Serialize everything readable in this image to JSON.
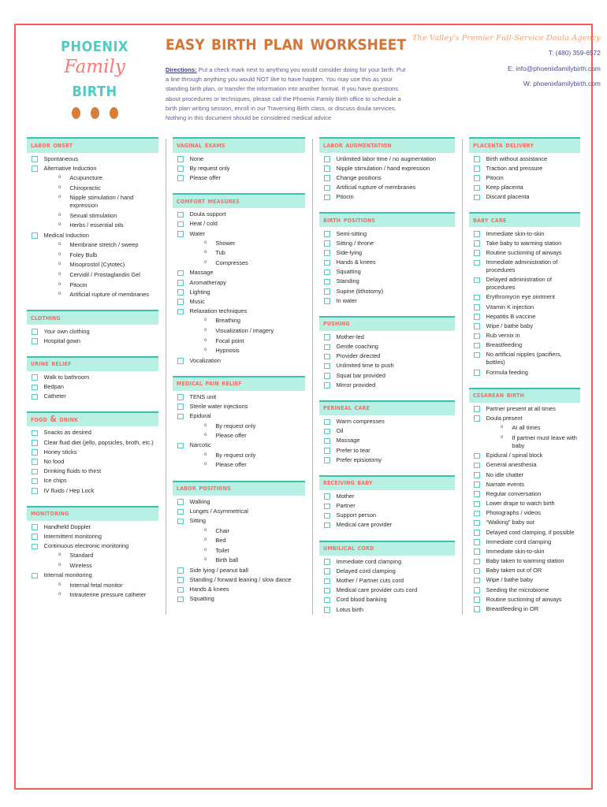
{
  "logo": {
    "line1": "Phoenix",
    "line2": "Family",
    "line3": "Birth",
    "dot_color": "#d4803c",
    "teal": "#4ecdc4",
    "coral": "#fb7a72"
  },
  "header": {
    "title": "Easy Birth Plan Worksheet",
    "directions_label": "Directions:",
    "directions_text": " Put a check mark next to anything you would consider doing for your birth. Put a line through anything you would NOT like to have happen. You may use this as your standing birth plan, or transfer the information into another format. If you have questions about procedures or techniques, please call the Phoenix Family Birth office to schedule a birth plan writing session, enroll in our Traversing Birth class, or discuss doula services. Nothing in this document should be considered medical advice",
    "tagline": "The Valley's Premier Full-Service Doula Agency",
    "phone": "T: (480) 359-6572",
    "email": "E: info@phoenixfamilybirth.com",
    "website": "W: phoenixfamilybirth.com"
  },
  "colors": {
    "page_border": "#fb5b55",
    "section_bg": "#b8f0e4",
    "section_rule": "#3fbfae",
    "section_title": "#fb6a62",
    "checkbox_border": "#5bc8bd",
    "title_orange": "#d4763a"
  },
  "columns": [
    {
      "sections": [
        {
          "title": "Labor Onset",
          "items": [
            {
              "label": "Spontaneous",
              "subs": []
            },
            {
              "label": "Alternative Induction",
              "subs": [
                "Acupuncture",
                "Chiropractic",
                "Nipple stimulation / hand expression",
                "Sexual stimulation",
                "Herbs / essential oils"
              ]
            },
            {
              "label": "Medical Induction",
              "subs": [
                "Membrane stretch / sweep",
                "Foley Bulb",
                "Misoprostol (Cytotec)",
                "Cervidil / Prostaglandin Gel",
                "Pitocin",
                "Artificial rupture of membranes"
              ]
            }
          ]
        },
        {
          "title": "Clothing",
          "items": [
            {
              "label": "Your own clothing",
              "subs": []
            },
            {
              "label": "Hospital gown",
              "subs": []
            }
          ]
        },
        {
          "title": "Urine Relief",
          "items": [
            {
              "label": "Walk to bathroom",
              "subs": []
            },
            {
              "label": "Bedpan",
              "subs": []
            },
            {
              "label": "Catheter",
              "subs": []
            }
          ]
        },
        {
          "title": "Food & Drink",
          "items": [
            {
              "label": "Snacks as desired",
              "subs": []
            },
            {
              "label": "Clear fluid diet (jello, popsicles, broth, etc.)",
              "subs": []
            },
            {
              "label": "Honey sticks",
              "subs": []
            },
            {
              "label": "No food",
              "subs": []
            },
            {
              "label": "Drinking fluids to thirst",
              "subs": []
            },
            {
              "label": "Ice chips",
              "subs": []
            },
            {
              "label": "IV fluids / Hep Lock",
              "subs": []
            }
          ]
        },
        {
          "title": "Monitoring",
          "items": [
            {
              "label": "Handheld Doppler",
              "subs": []
            },
            {
              "label": "Intermittent monitoring",
              "subs": []
            },
            {
              "label": "Continuous electronic monitoring",
              "subs": [
                "Standard",
                "Wireless"
              ]
            },
            {
              "label": "Internal monitoring",
              "subs": [
                "Internal fetal monitor",
                "Intrauterine pressure catheter"
              ]
            }
          ]
        }
      ]
    },
    {
      "sections": [
        {
          "title": "Vaginal Exams",
          "items": [
            {
              "label": "None",
              "subs": []
            },
            {
              "label": "By request only",
              "subs": []
            },
            {
              "label": "Please offer",
              "subs": []
            }
          ]
        },
        {
          "title": "Comfort Measures",
          "items": [
            {
              "label": "Doula support",
              "subs": []
            },
            {
              "label": "Heat / cold",
              "subs": []
            },
            {
              "label": "Water",
              "subs": [
                "Shower",
                "Tub",
                "Compresses"
              ]
            },
            {
              "label": "Massage",
              "subs": []
            },
            {
              "label": "Aromatherapy",
              "subs": []
            },
            {
              "label": "Lighting",
              "subs": []
            },
            {
              "label": "Music",
              "subs": []
            },
            {
              "label": "Relaxation techniques",
              "subs": [
                "Breathing",
                "Visualization / imagery",
                "Focal point",
                "Hypnosis"
              ]
            },
            {
              "label": "Vocalization",
              "subs": []
            }
          ]
        },
        {
          "title": "Medical Pain Relief",
          "items": [
            {
              "label": "TENS unit",
              "subs": []
            },
            {
              "label": "Sterile water injections",
              "subs": []
            },
            {
              "label": "Epidural",
              "subs": [
                "By request only",
                "Please offer"
              ]
            },
            {
              "label": "Narcotic",
              "subs": [
                "By request only",
                "Please offer"
              ]
            }
          ]
        },
        {
          "title": "Labor Positions",
          "items": [
            {
              "label": "Walking",
              "subs": []
            },
            {
              "label": "Lunges / Asymmetrical",
              "subs": []
            },
            {
              "label": "Sitting",
              "subs": [
                "Chair",
                "Bed",
                "Toilet",
                "Birth ball"
              ]
            },
            {
              "label": "Side lying / peanut ball",
              "subs": []
            },
            {
              "label": "Standing / forward leaning / slow dance",
              "subs": []
            },
            {
              "label": "Hands & knees",
              "subs": []
            },
            {
              "label": "Squatting",
              "subs": []
            }
          ]
        }
      ]
    },
    {
      "sections": [
        {
          "title": "Labor Augmentation",
          "items": [
            {
              "label": "Unlimited labor time / no augmentation",
              "subs": []
            },
            {
              "label": "Nipple stimulation / hand expression",
              "subs": []
            },
            {
              "label": "Change positions",
              "subs": []
            },
            {
              "label": "Artificial rupture of membranes",
              "subs": []
            },
            {
              "label": "Pitocin",
              "subs": []
            }
          ]
        },
        {
          "title": "Birth Positions",
          "items": [
            {
              "label": "Semi-sitting",
              "subs": []
            },
            {
              "label": "Sitting / throne",
              "subs": []
            },
            {
              "label": "Side-lying",
              "subs": []
            },
            {
              "label": "Hands & knees",
              "subs": []
            },
            {
              "label": "Squatting",
              "subs": []
            },
            {
              "label": "Standing",
              "subs": []
            },
            {
              "label": "Supine (lithotomy)",
              "subs": []
            },
            {
              "label": "In water",
              "subs": []
            }
          ]
        },
        {
          "title": "Pushing",
          "items": [
            {
              "label": "Mother-led",
              "subs": []
            },
            {
              "label": "Gentle coaching",
              "subs": []
            },
            {
              "label": "Provider directed",
              "subs": []
            },
            {
              "label": "Unlimited time to push",
              "subs": []
            },
            {
              "label": "Squat bar provided",
              "subs": []
            },
            {
              "label": "Mirror provided",
              "subs": []
            }
          ]
        },
        {
          "title": "Perineal Care",
          "items": [
            {
              "label": "Warm compresses",
              "subs": []
            },
            {
              "label": "Oil",
              "subs": []
            },
            {
              "label": "Massage",
              "subs": []
            },
            {
              "label": "Prefer to tear",
              "subs": []
            },
            {
              "label": "Prefer episiotomy",
              "subs": []
            }
          ]
        },
        {
          "title": "Receiving Baby",
          "items": [
            {
              "label": "Mother",
              "subs": []
            },
            {
              "label": "Partner",
              "subs": []
            },
            {
              "label": "Support person",
              "subs": []
            },
            {
              "label": "Medical care provider",
              "subs": []
            }
          ]
        },
        {
          "title": "Umbilical Cord",
          "items": [
            {
              "label": "Immediate cord clamping",
              "subs": []
            },
            {
              "label": "Delayed cord clamping",
              "subs": []
            },
            {
              "label": "Mother / Partner cuts cord",
              "subs": []
            },
            {
              "label": "Medical care provider cuts cord",
              "subs": []
            },
            {
              "label": "Cord blood banking",
              "subs": []
            },
            {
              "label": "Lotus birth",
              "subs": []
            }
          ]
        }
      ]
    },
    {
      "sections": [
        {
          "title": "Placenta Delivery",
          "items": [
            {
              "label": "Birth without assistance",
              "subs": []
            },
            {
              "label": "Traction and pressure",
              "subs": []
            },
            {
              "label": "Pitocin",
              "subs": []
            },
            {
              "label": "Keep placenta",
              "subs": []
            },
            {
              "label": "Discard placenta",
              "subs": []
            }
          ]
        },
        {
          "title": "Baby Care",
          "items": [
            {
              "label": "Immediate skin-to-skin",
              "subs": []
            },
            {
              "label": "Take baby to warming station",
              "subs": []
            },
            {
              "label": "Routine suctioning of airways",
              "subs": []
            },
            {
              "label": "Immediate administration of procedures",
              "subs": []
            },
            {
              "label": "Delayed administration of procedures",
              "subs": []
            },
            {
              "label": "Erythromycin eye ointment",
              "subs": []
            },
            {
              "label": "Vitamin K injection",
              "subs": []
            },
            {
              "label": "Hepatitis B vaccine",
              "subs": []
            },
            {
              "label": "Wipe / bathe baby",
              "subs": []
            },
            {
              "label": "Rub vernix in",
              "subs": []
            },
            {
              "label": "Breastfeeding",
              "subs": []
            },
            {
              "label": "No artificial nipples (pacifiers, bottles)",
              "subs": []
            },
            {
              "label": "Formula feeding",
              "subs": []
            }
          ]
        },
        {
          "title": "Cesarean Birth",
          "items": [
            {
              "label": "Partner present at all times",
              "subs": []
            },
            {
              "label": "Doula present",
              "subs": [
                "At all times",
                "If partner must leave with baby"
              ]
            },
            {
              "label": "Epidural / spinal block",
              "subs": []
            },
            {
              "label": "General anesthesia",
              "subs": []
            },
            {
              "label": "No idle chatter",
              "subs": []
            },
            {
              "label": "Narrate events",
              "subs": []
            },
            {
              "label": "Regular conversation",
              "subs": []
            },
            {
              "label": "Lower drape to watch birth",
              "subs": []
            },
            {
              "label": "Photographs / videos",
              "subs": []
            },
            {
              "label": "“Walking” baby out",
              "subs": []
            },
            {
              "label": "Delayed cord clamping, if possible",
              "subs": []
            },
            {
              "label": "Immediate cord clamping",
              "subs": []
            },
            {
              "label": "Immediate skin-to-skin",
              "subs": []
            },
            {
              "label": "Baby taken to warming station",
              "subs": []
            },
            {
              "label": "Baby taken out of OR",
              "subs": []
            },
            {
              "label": "Wipe / bathe baby",
              "subs": []
            },
            {
              "label": "Seeding the microbiome",
              "subs": []
            },
            {
              "label": "Routine suctioning of airways",
              "subs": []
            },
            {
              "label": "Breastfeeding in OR",
              "subs": []
            }
          ]
        }
      ]
    }
  ]
}
